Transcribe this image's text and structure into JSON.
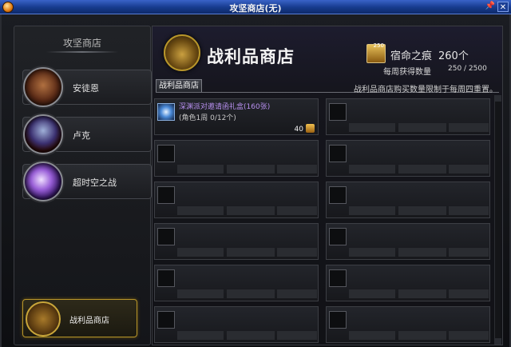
{
  "window": {
    "title": "攻坚商店(无)",
    "pin_glyph": "📌",
    "close_glyph": "✕"
  },
  "sidebar": {
    "header": "攻坚商店",
    "items": [
      {
        "label": "安徒恩",
        "icon": "anton-portrait-icon"
      },
      {
        "label": "卢克",
        "icon": "luke-portrait-icon"
      },
      {
        "label": "超时空之战",
        "icon": "chrono-war-portrait-icon"
      }
    ],
    "active_item": {
      "label": "战利品商店",
      "icon": "treasure-chest-icon"
    }
  },
  "shop": {
    "title": "战利品商店",
    "currency": {
      "name": "宿命之痕",
      "count": "260个",
      "icon_number": "250"
    },
    "weekly": {
      "label": "每周获得数量",
      "value": "250 / 2500"
    },
    "tab_label": "战利品商店",
    "notice": "战利品商店购买数量限制于每周四重置。",
    "items": [
      {
        "name": "深渊派对邀请函礼盒(160张)",
        "limit": "(角色1周 0/12个)",
        "price": "40"
      }
    ]
  },
  "colors": {
    "accent_gold": "#b8962a",
    "item_name_purple": "#b890f0",
    "titlebar_blue": "#163a8c"
  }
}
